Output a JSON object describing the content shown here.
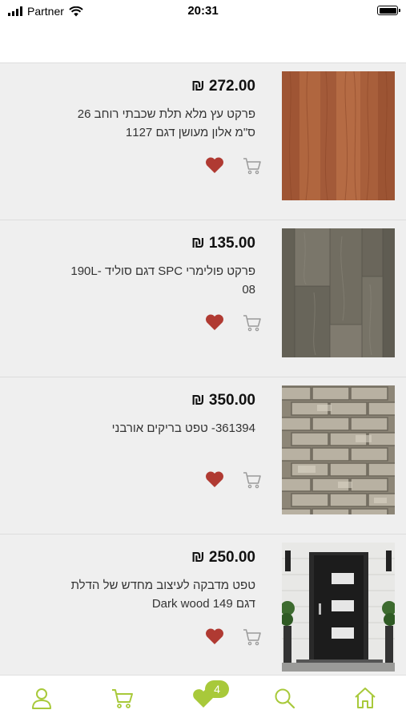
{
  "status_bar": {
    "carrier": "Partner",
    "time": "20:31"
  },
  "products": [
    {
      "price": "₪ 272.00",
      "title": "פרקט עץ מלא תלת שכבתי רוחב 26 ס\"מ אלון מעושן דגם 1127"
    },
    {
      "price": "₪ 135.00",
      "title": "פרקט פולימרי SPC דגם סוליד 190L-08"
    },
    {
      "price": "₪ 350.00",
      "title": "361394- טפט בריקים אורבני"
    },
    {
      "price": "₪ 250.00",
      "title": "טפט מדבקה לעיצוב מחדש של הדלת דגם Dark wood 149"
    }
  ],
  "tabbar": {
    "favorites_count": "4"
  },
  "colors": {
    "accent": "#a8c93a",
    "heart": "#b03a32"
  }
}
